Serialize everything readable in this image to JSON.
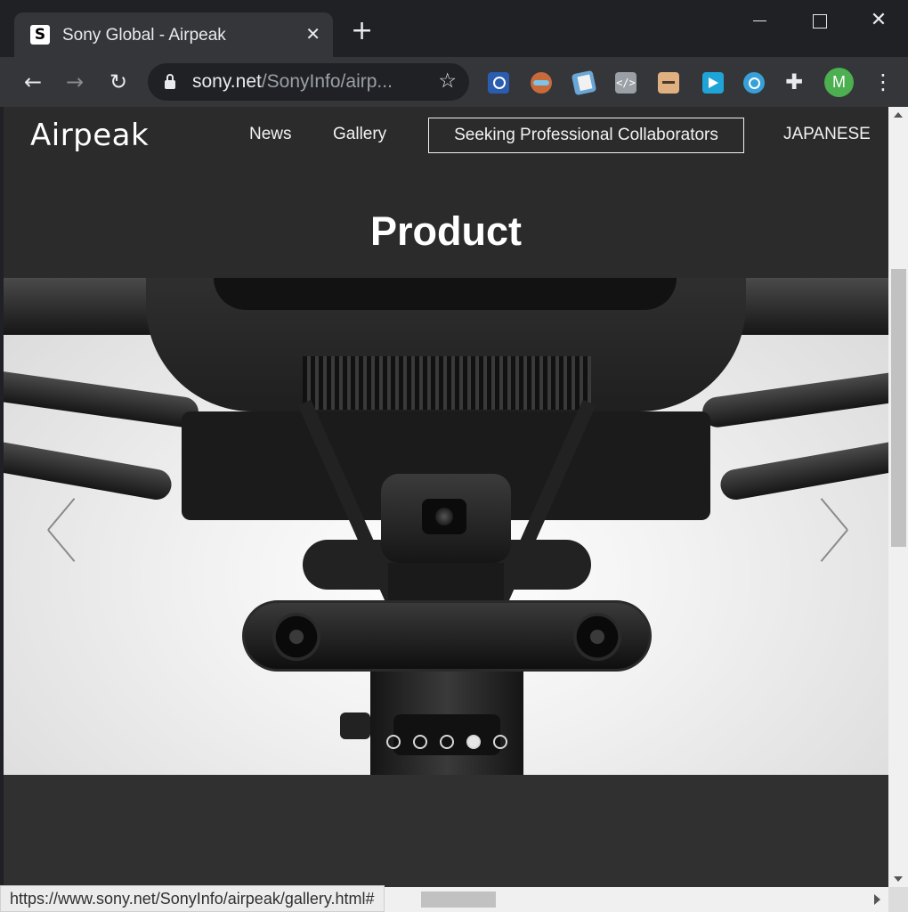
{
  "browser": {
    "tab": {
      "favicon": "S",
      "title": "Sony Global - Airpeak",
      "close": "✕"
    },
    "new_tab": "+",
    "window": {
      "close": "✕"
    },
    "toolbar": {
      "back": "←",
      "forward": "→",
      "reload": "↻",
      "url_host": "sony.net",
      "url_path": "/SonyInfo/airp...",
      "bookmark": "☆",
      "extensions": [
        "search-extension-icon",
        "owl-extension-icon",
        "notes-extension-icon",
        "code-extension-icon",
        "box-extension-icon",
        "share-extension-icon",
        "lookup-extension-icon"
      ],
      "code_extension_label": "</>",
      "puzzle": "✚",
      "avatar_initial": "M",
      "menu": "⋮"
    },
    "status_url": "https://www.sony.net/SonyInfo/airpeak/gallery.html#"
  },
  "site": {
    "logo": "Airpeak",
    "nav": {
      "news": "News",
      "gallery": "Gallery",
      "collaborators": "Seeking Professional Collaborators",
      "japanese": "JAPANESE"
    },
    "heading": "Product",
    "carousel": {
      "slide_count": 5,
      "active_slide": 4
    }
  },
  "colors": {
    "page_bg": "#2b2b2b",
    "browser_frame": "#202124",
    "toolbar": "#35363a",
    "avatar": "#4caf50"
  }
}
